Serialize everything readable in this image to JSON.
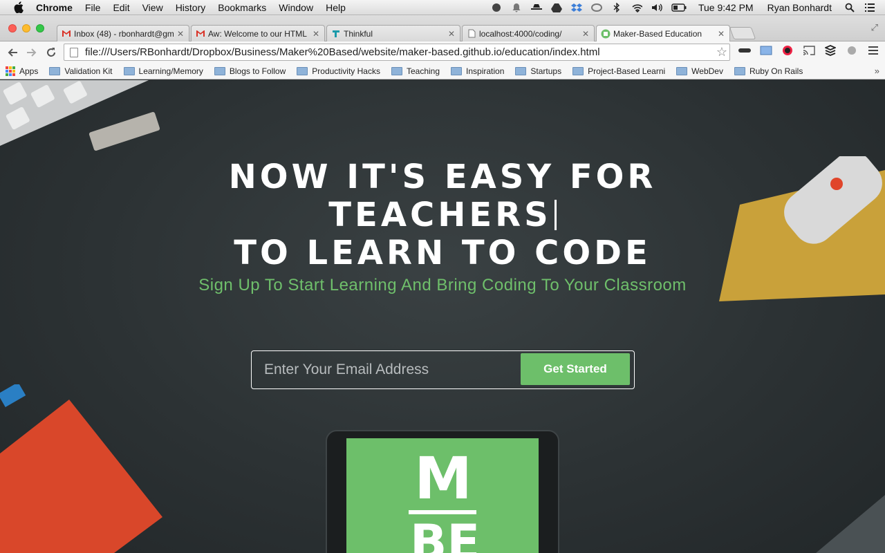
{
  "menubar": {
    "app_name": "Chrome",
    "menus": [
      "File",
      "Edit",
      "View",
      "History",
      "Bookmarks",
      "Window",
      "Help"
    ],
    "clock": "Tue 9:42 PM",
    "user": "Ryan Bonhardt"
  },
  "tabs": [
    {
      "title": "Inbox (48) - rbonhardt@gm",
      "icon": "gmail-icon"
    },
    {
      "title": "Aw: Welcome to our HTML",
      "icon": "gmail-icon"
    },
    {
      "title": "Thinkful",
      "icon": "thinkful-icon"
    },
    {
      "title": "localhost:4000/coding/",
      "icon": "page-icon"
    },
    {
      "title": "Maker-Based Education",
      "icon": "maker-icon"
    }
  ],
  "address_bar": {
    "url": "file:///Users/RBonhardt/Dropbox/Business/Maker%20Based/website/maker-based.github.io/education/index.html"
  },
  "bookmarks": {
    "apps_label": "Apps",
    "items": [
      "Validation Kit",
      "Learning/Memory",
      "Blogs to Follow",
      "Productivity Hacks",
      "Teaching",
      "Inspiration",
      "Startups",
      "Project-Based Learni",
      "WebDev",
      "Ruby On Rails"
    ]
  },
  "hero": {
    "line1": "NOW IT'S EASY FOR",
    "line2": "TEACHERS",
    "line3": "TO LEARN TO CODE",
    "subtitle": "Sign Up To Start Learning And Bring Coding To Your Classroom"
  },
  "signup": {
    "email_placeholder": "Enter Your Email Address",
    "button_label": "Get Started"
  },
  "tablet_logo": {
    "top": "M",
    "bottom": "BE"
  },
  "colors": {
    "accent_green": "#6dbf6a",
    "page_bg": "#2c3234"
  }
}
